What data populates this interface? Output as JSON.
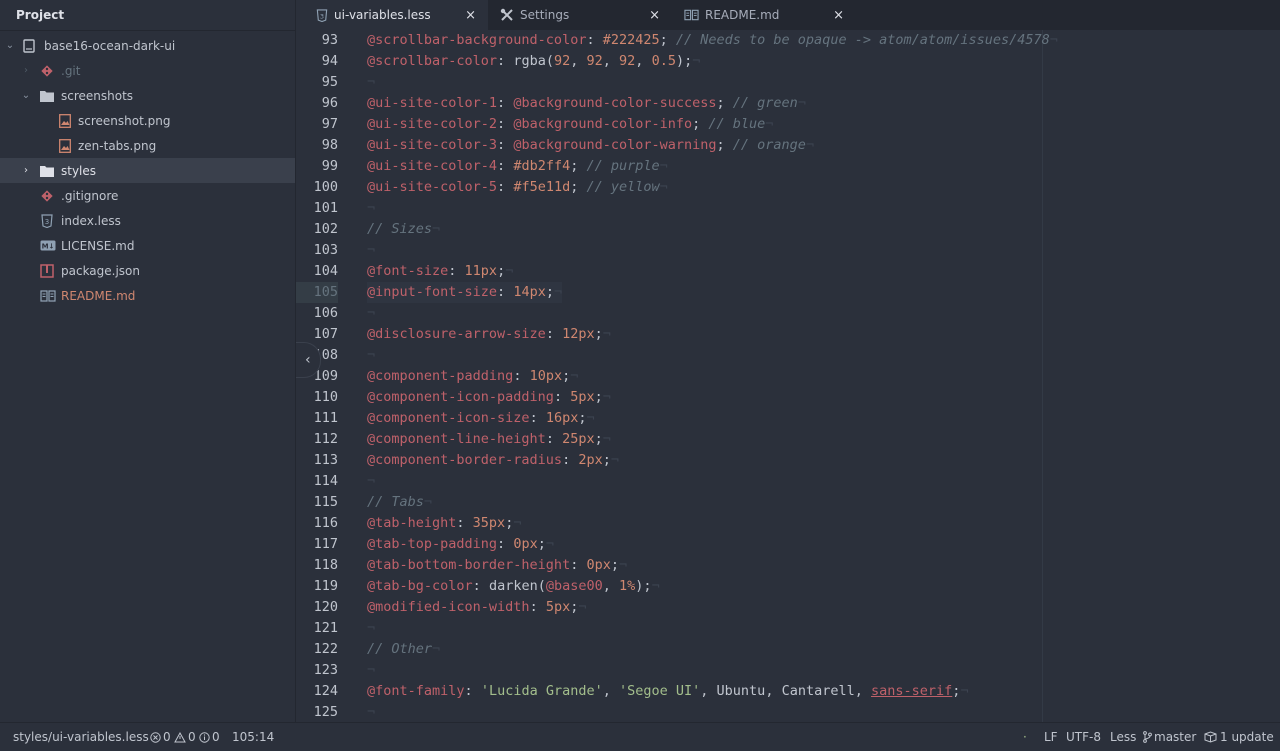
{
  "sidebar": {
    "title": "Project",
    "items": [
      {
        "label": "base16-ocean-dark-ui",
        "icon": "repo-icon",
        "color": "#c0c5ce"
      },
      {
        "label": ".git",
        "icon": "git-icon",
        "color": "#65737e"
      },
      {
        "label": "screenshots",
        "icon": "folder-icon",
        "color": "#c0c5ce"
      },
      {
        "label": "screenshot.png",
        "icon": "image-icon",
        "color": "#c0c5ce"
      },
      {
        "label": "zen-tabs.png",
        "icon": "image-icon",
        "color": "#c0c5ce"
      },
      {
        "label": "styles",
        "icon": "folder-icon",
        "color": "#dfe1e8"
      },
      {
        "label": ".gitignore",
        "icon": "git-icon",
        "color": "#c0c5ce"
      },
      {
        "label": "index.less",
        "icon": "css-icon",
        "color": "#c0c5ce"
      },
      {
        "label": "LICENSE.md",
        "icon": "markdown-icon",
        "color": "#c0c5ce"
      },
      {
        "label": "package.json",
        "icon": "package-icon",
        "color": "#c0c5ce"
      },
      {
        "label": "README.md",
        "icon": "book-icon",
        "color": "#d08770"
      }
    ]
  },
  "tabs": [
    {
      "label": "ui-variables.less",
      "icon": "css-icon",
      "close": "×"
    },
    {
      "label": "Settings",
      "icon": "tools-icon",
      "close": "×"
    },
    {
      "label": "README.md",
      "icon": "book-icon",
      "close": "×"
    }
  ],
  "editor": {
    "line_numbers": [
      "93",
      "94",
      "95",
      "96",
      "97",
      "98",
      "99",
      "100",
      "101",
      "102",
      "103",
      "104",
      "105",
      "106",
      "107",
      "108",
      "109",
      "110",
      "111",
      "112",
      "113",
      "114",
      "115",
      "116",
      "117",
      "118",
      "119",
      "120",
      "121",
      "122",
      "123",
      "124",
      "125"
    ],
    "cursor_line_index": 12,
    "lines": [
      [
        [
          "@scrollbar-background-color",
          "var"
        ],
        [
          ": ",
          "punc"
        ],
        [
          "#222425",
          "num"
        ],
        [
          "; ",
          "punc"
        ],
        [
          "// Needs to be opaque -> atom/atom/issues/4578",
          "com"
        ]
      ],
      [
        [
          "@scrollbar-color",
          "var"
        ],
        [
          ": ",
          "punc"
        ],
        [
          "rgba",
          "fn"
        ],
        [
          "(",
          "punc"
        ],
        [
          "92",
          "num"
        ],
        [
          ", ",
          "punc"
        ],
        [
          "92",
          "num"
        ],
        [
          ", ",
          "punc"
        ],
        [
          "92",
          "num"
        ],
        [
          ", ",
          "punc"
        ],
        [
          "0.5",
          "num"
        ],
        [
          ");",
          "punc"
        ]
      ],
      [],
      [
        [
          "@ui-site-color-1",
          "var"
        ],
        [
          ": ",
          "punc"
        ],
        [
          "@background-color-success",
          "var"
        ],
        [
          "; ",
          "punc"
        ],
        [
          "// green",
          "com"
        ]
      ],
      [
        [
          "@ui-site-color-2",
          "var"
        ],
        [
          ": ",
          "punc"
        ],
        [
          "@background-color-info",
          "var"
        ],
        [
          "; ",
          "punc"
        ],
        [
          "// blue",
          "com"
        ]
      ],
      [
        [
          "@ui-site-color-3",
          "var"
        ],
        [
          ": ",
          "punc"
        ],
        [
          "@background-color-warning",
          "var"
        ],
        [
          "; ",
          "punc"
        ],
        [
          "// orange",
          "com"
        ]
      ],
      [
        [
          "@ui-site-color-4",
          "var"
        ],
        [
          ": ",
          "punc"
        ],
        [
          "#db2ff4",
          "num"
        ],
        [
          "; ",
          "punc"
        ],
        [
          "// purple",
          "com"
        ]
      ],
      [
        [
          "@ui-site-color-5",
          "var"
        ],
        [
          ": ",
          "punc"
        ],
        [
          "#f5e11d",
          "num"
        ],
        [
          "; ",
          "punc"
        ],
        [
          "// yellow",
          "com"
        ]
      ],
      [],
      [
        [
          "// Sizes",
          "com"
        ]
      ],
      [],
      [
        [
          "@font-size",
          "var"
        ],
        [
          ": ",
          "punc"
        ],
        [
          "11px",
          "num"
        ],
        [
          ";",
          "punc"
        ]
      ],
      [
        [
          "@input-font-size",
          "var"
        ],
        [
          ": ",
          "punc"
        ],
        [
          "14px",
          "num"
        ],
        [
          ";",
          "punc"
        ]
      ],
      [],
      [
        [
          "@disclosure-arrow-size",
          "var"
        ],
        [
          ": ",
          "punc"
        ],
        [
          "12px",
          "num"
        ],
        [
          ";",
          "punc"
        ]
      ],
      [],
      [
        [
          "@component-padding",
          "var"
        ],
        [
          ": ",
          "punc"
        ],
        [
          "10px",
          "num"
        ],
        [
          ";",
          "punc"
        ]
      ],
      [
        [
          "@component-icon-padding",
          "var"
        ],
        [
          ": ",
          "punc"
        ],
        [
          "5px",
          "num"
        ],
        [
          ";",
          "punc"
        ]
      ],
      [
        [
          "@component-icon-size",
          "var"
        ],
        [
          ": ",
          "punc"
        ],
        [
          "16px",
          "num"
        ],
        [
          ";",
          "punc"
        ]
      ],
      [
        [
          "@component-line-height",
          "var"
        ],
        [
          ": ",
          "punc"
        ],
        [
          "25px",
          "num"
        ],
        [
          ";",
          "punc"
        ]
      ],
      [
        [
          "@component-border-radius",
          "var"
        ],
        [
          ": ",
          "punc"
        ],
        [
          "2px",
          "num"
        ],
        [
          ";",
          "punc"
        ]
      ],
      [],
      [
        [
          "// Tabs",
          "com"
        ]
      ],
      [
        [
          "@tab-height",
          "var"
        ],
        [
          ": ",
          "punc"
        ],
        [
          "35px",
          "num"
        ],
        [
          ";",
          "punc"
        ]
      ],
      [
        [
          "@tab-top-padding",
          "var"
        ],
        [
          ": ",
          "punc"
        ],
        [
          "0px",
          "num"
        ],
        [
          ";",
          "punc"
        ]
      ],
      [
        [
          "@tab-bottom-border-height",
          "var"
        ],
        [
          ": ",
          "punc"
        ],
        [
          "0px",
          "num"
        ],
        [
          ";",
          "punc"
        ]
      ],
      [
        [
          "@tab-bg-color",
          "var"
        ],
        [
          ": ",
          "punc"
        ],
        [
          "darken",
          "fn"
        ],
        [
          "(",
          "punc"
        ],
        [
          "@base00",
          "var"
        ],
        [
          ", ",
          "punc"
        ],
        [
          "1%",
          "num"
        ],
        [
          ");",
          "punc"
        ]
      ],
      [
        [
          "@modified-icon-width",
          "var"
        ],
        [
          ": ",
          "punc"
        ],
        [
          "5px",
          "num"
        ],
        [
          ";",
          "punc"
        ]
      ],
      [],
      [
        [
          "// Other",
          "com"
        ]
      ],
      [],
      [
        [
          "@font-family",
          "var"
        ],
        [
          ": ",
          "punc"
        ],
        [
          "'Lucida Grande'",
          "str"
        ],
        [
          ", ",
          "punc"
        ],
        [
          "'Segoe UI'",
          "str"
        ],
        [
          ", ",
          "punc"
        ],
        [
          "Ubuntu",
          "fn"
        ],
        [
          ", ",
          "punc"
        ],
        [
          "Cantarell",
          "fn"
        ],
        [
          ", ",
          "punc"
        ],
        [
          "sans-serif",
          "under"
        ],
        [
          ";",
          "punc"
        ]
      ],
      []
    ]
  },
  "status": {
    "file_path": "styles/ui-variables.less",
    "errors": "0",
    "warnings": "0",
    "infos": "0",
    "cursor_position": "105:14",
    "line_ending": "LF",
    "encoding": "UTF-8",
    "grammar": "Less",
    "branch": "master",
    "updates": "1 update"
  },
  "colors": {
    "background": "#2b303b",
    "variable": "#bf616a",
    "number": "#d08770",
    "comment": "#65737e",
    "string": "#a3be8c"
  }
}
